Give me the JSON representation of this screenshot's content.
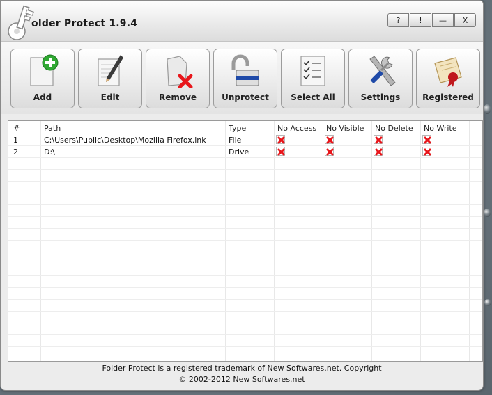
{
  "app": {
    "title": "older Protect 1.9.4"
  },
  "window_controls": [
    {
      "id": "help",
      "label": "?"
    },
    {
      "id": "info",
      "label": "!"
    },
    {
      "id": "minimize",
      "label": "—"
    },
    {
      "id": "close",
      "label": "X"
    }
  ],
  "toolbar": {
    "add_label": "Add",
    "edit_label": "Edit",
    "remove_label": "Remove",
    "unprotect_label": "Unprotect",
    "select_all_label": "Select All",
    "settings_label": "Settings",
    "registered_label": "Registered"
  },
  "table": {
    "headers": {
      "num": "#",
      "path": "Path",
      "type": "Type",
      "no_access": "No Access",
      "no_visible": "No Visible",
      "no_delete": "No Delete",
      "no_write": "No Write"
    },
    "rows": [
      {
        "num": "1",
        "path": "C:\\Users\\Public\\Desktop\\Mozilla Firefox.lnk",
        "type": "File"
      },
      {
        "num": "2",
        "path": "D:\\",
        "type": "Drive"
      }
    ]
  },
  "footer": {
    "line1": "Folder Protect is a registered trademark of New Softwares.net. Copyright",
    "line2": "© 2002-2012 New Softwares.net"
  },
  "colors": {
    "accent_red": "#e8161b",
    "add_green": "#2fa832"
  }
}
